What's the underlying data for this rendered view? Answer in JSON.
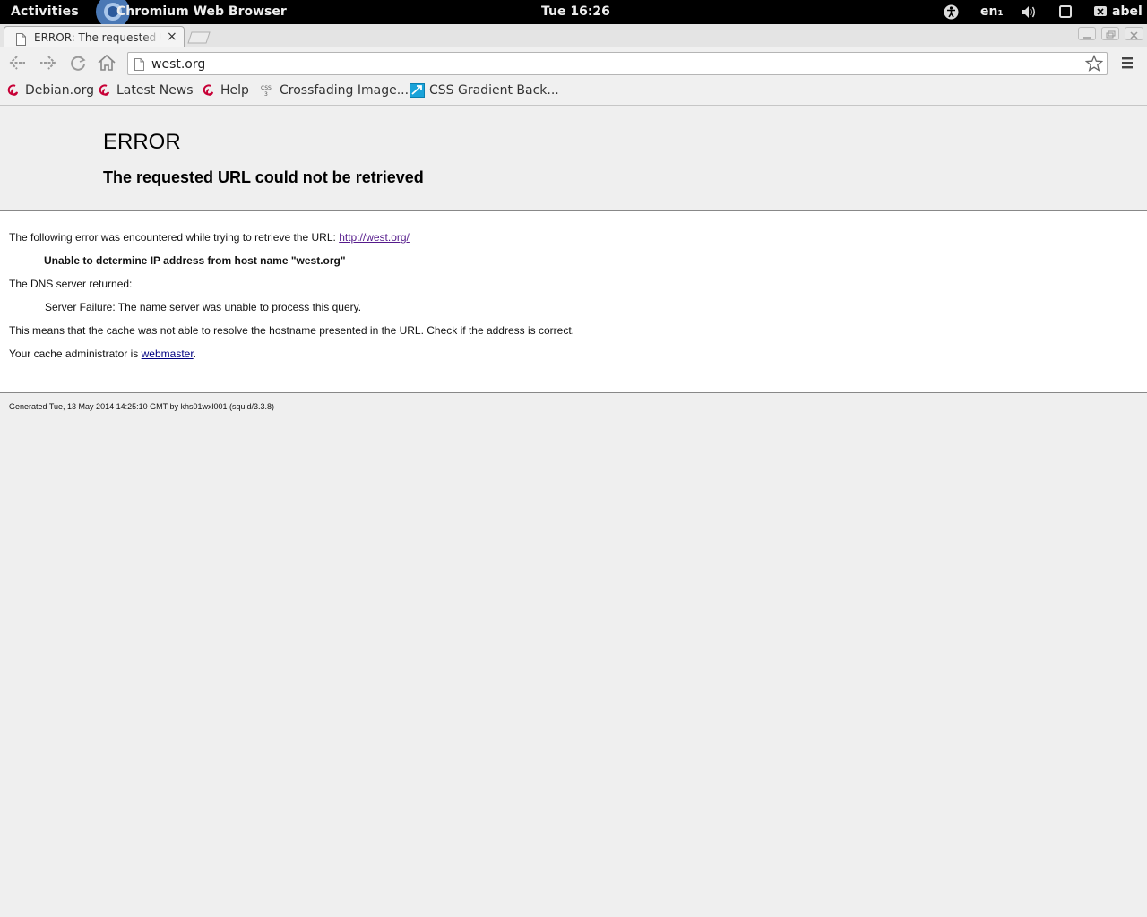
{
  "topbar": {
    "activities": "Activities",
    "app_name": "Chromium Web Browser",
    "clock": "Tue 16:26",
    "language": "en₁",
    "user": "abel"
  },
  "tabs": [
    {
      "title": "ERROR: The requested URL could not be retrieved",
      "close": "×"
    }
  ],
  "omnibox": {
    "url": "west.org"
  },
  "bookmarks": [
    {
      "label": "Debian.org",
      "icon": "debian-swirl-icon"
    },
    {
      "label": "Latest News",
      "icon": "debian-swirl-icon"
    },
    {
      "label": "Help",
      "icon": "debian-swirl-icon"
    },
    {
      "label": "Crossfading Image...",
      "icon": "css3-icon"
    },
    {
      "label": "CSS Gradient Back...",
      "icon": "gradient-icon"
    }
  ],
  "page": {
    "heading": "ERROR",
    "subheading": "The requested URL could not be retrieved",
    "intro": "The following error was encountered while trying to retrieve the URL: ",
    "intro_link": "http://west.org/",
    "error_message": "Unable to determine IP address from host name \"west.org\"",
    "dns_label": "The DNS server returned:",
    "dns_message": "Server Failure: The name server was unable to process this query.",
    "explanation": "This means that the cache was not able to resolve the hostname presented in the URL. Check if the address is correct.",
    "admin_prefix": "Your cache administrator is ",
    "admin_link": "webmaster",
    "admin_suffix": ".",
    "footer": "Generated Tue, 13 May 2014 14:25:10 GMT by khs01wxl001 (squid/3.3.8)"
  },
  "colors": {
    "topbar_bg": "#000000",
    "link": "#000080",
    "visited_link": "#551a8b",
    "debian_red": "#c70036"
  }
}
